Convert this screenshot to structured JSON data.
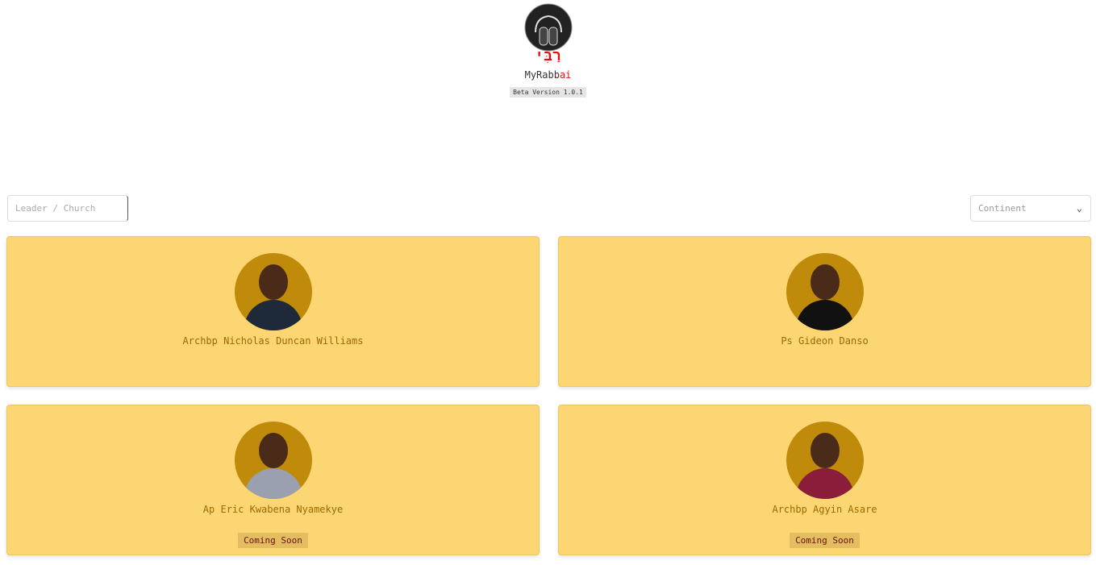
{
  "header": {
    "hebrew": "רַבִּי",
    "app_name_prefix": "MyRabb",
    "app_name_suffix": "ai",
    "beta": "Beta Version 1.0.1"
  },
  "filters": {
    "search_placeholder": "Leader / Church",
    "continent": "Continent"
  },
  "cards": [
    {
      "name": "Archbp Nicholas Duncan Williams"
    },
    {
      "name": "Ps Gideon Danso"
    },
    {
      "name": "Ap Eric Kwabena Nyamekye",
      "status": "Coming Soon"
    },
    {
      "name": "Archbp Agyin Asare",
      "status": "Coming Soon"
    }
  ],
  "colors": {
    "card": "#fcd672",
    "accent": "#e41010",
    "avatar_bg": "#c08a0a"
  }
}
